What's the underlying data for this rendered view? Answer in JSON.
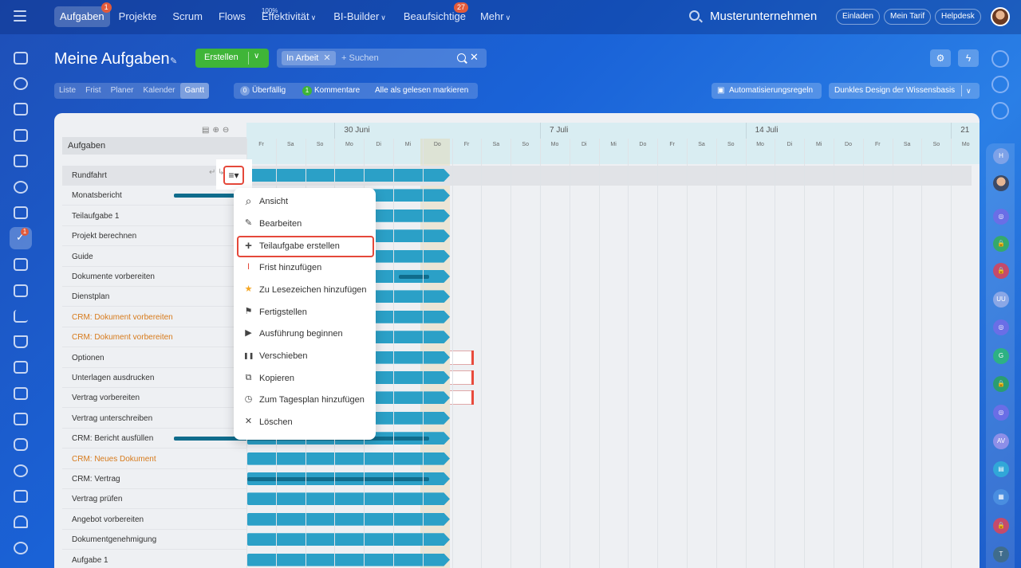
{
  "topbar": {
    "nav": [
      {
        "label": "Aufgaben",
        "badge": "1",
        "active": true
      },
      {
        "label": "Projekte"
      },
      {
        "label": "Scrum"
      },
      {
        "label": "Flows"
      },
      {
        "label": "Effektivität",
        "sup": "100%",
        "chevron": true
      },
      {
        "label": "BI-Builder",
        "chevron": true
      },
      {
        "label": "Beaufsichtige",
        "badge": "27"
      },
      {
        "label": "Mehr",
        "chevron": true
      }
    ],
    "company": "Musterunternehmen",
    "invite": "Einladen",
    "tariff": "Mein Tarif",
    "helpdesk": "Helpdesk"
  },
  "sidebar": {
    "tasks_badge": "1"
  },
  "header": {
    "title": "Meine Aufgaben",
    "create": "Erstellen",
    "filter_chip": "In Arbeit",
    "search_placeholder": "+ Suchen"
  },
  "views": [
    "Liste",
    "Frist",
    "Planer",
    "Kalender",
    "Gantt"
  ],
  "counters": {
    "overdue_count": "0",
    "overdue_label": "Überfällig",
    "comments_count": "1",
    "comments_label": "Kommentare",
    "mark_read": "Alle als gelesen markieren"
  },
  "automation": "Automatisierungsregeln",
  "theme": "Dunkles Design der Wissensbasis",
  "gantt": {
    "column_header": "Aufgaben",
    "weeks": [
      "30 Juni",
      "7 Juli",
      "14 Juli",
      "21"
    ],
    "days": [
      "Fr",
      "Sa",
      "So",
      "Mo",
      "Di",
      "Mi",
      "Do",
      "Fr",
      "Sa",
      "So",
      "Mo",
      "Di",
      "Mi",
      "Do",
      "Fr",
      "Sa",
      "So",
      "Mo",
      "Di",
      "Mi",
      "Do",
      "Fr",
      "Sa",
      "So",
      "Mo"
    ],
    "tasks": [
      {
        "name": "Rundfahrt"
      },
      {
        "name": "Monatsbericht"
      },
      {
        "name": "Teilaufgabe 1"
      },
      {
        "name": "Projekt berechnen"
      },
      {
        "name": "Guide"
      },
      {
        "name": "Dokumente vorbereiten"
      },
      {
        "name": "Dienstplan"
      },
      {
        "name": "CRM: Dokument vorbereiten",
        "crm": true
      },
      {
        "name": "CRM: Dokument vorbereiten",
        "crm": true
      },
      {
        "name": "Optionen"
      },
      {
        "name": "Unterlagen ausdrucken"
      },
      {
        "name": "Vertrag vorbereiten"
      },
      {
        "name": "Vertrag unterschreiben"
      },
      {
        "name": "CRM: Bericht ausfüllen"
      },
      {
        "name": "CRM: Neues Dokument",
        "crm": true
      },
      {
        "name": "CRM: Vertrag"
      },
      {
        "name": "Vertrag prüfen"
      },
      {
        "name": "Angebot vorbereiten"
      },
      {
        "name": "Dokumentgenehmigung"
      },
      {
        "name": "Aufgabe 1"
      }
    ]
  },
  "context_menu": [
    {
      "label": "Ansicht",
      "icon": "search-icon"
    },
    {
      "label": "Bearbeiten",
      "icon": "pencil-icon"
    },
    {
      "label": "Teilaufgabe erstellen",
      "icon": "plus-icon",
      "highlighted": true
    },
    {
      "label": "Frist hinzufügen",
      "icon": "deadline-icon"
    },
    {
      "label": "Zu Lesezeichen hinzufügen",
      "icon": "star-icon"
    },
    {
      "label": "Fertigstellen",
      "icon": "flag-icon"
    },
    {
      "label": "Ausführung beginnen",
      "icon": "play-icon"
    },
    {
      "label": "Verschieben",
      "icon": "pause-icon"
    },
    {
      "label": "Kopieren",
      "icon": "copy-icon"
    },
    {
      "label": "Zum Tagesplan hinzufügen",
      "icon": "clock-icon"
    },
    {
      "label": "Löschen",
      "icon": "close-icon"
    }
  ]
}
